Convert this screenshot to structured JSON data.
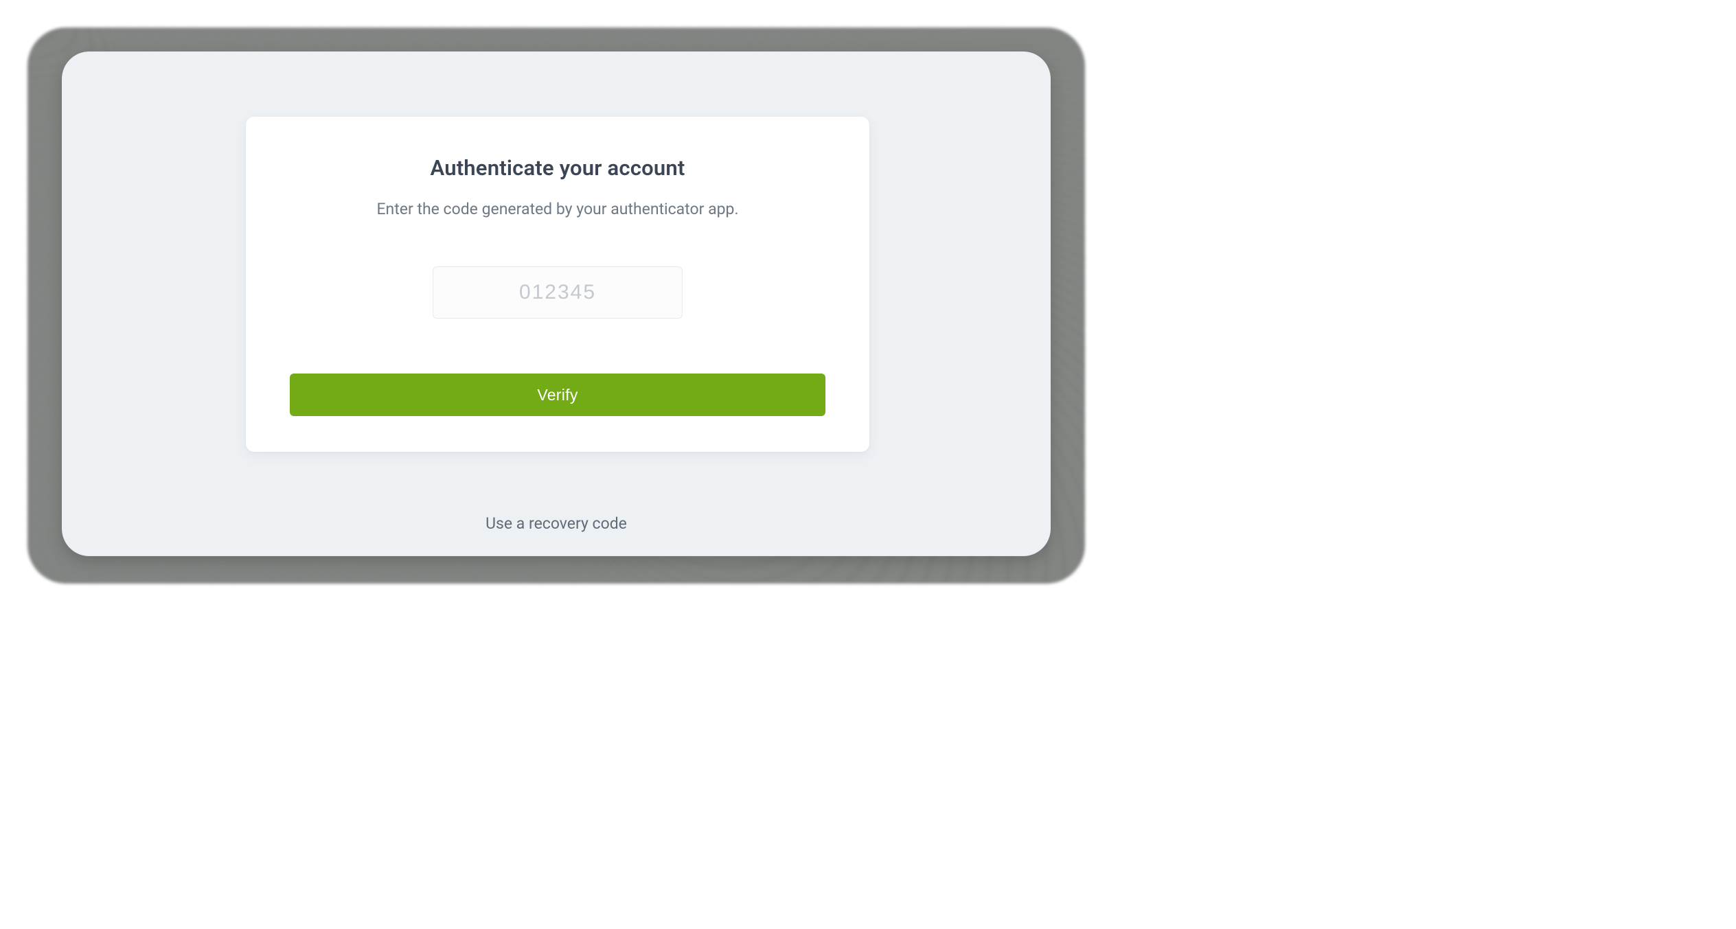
{
  "auth": {
    "title": "Authenticate your account",
    "subtitle": "Enter the code generated by your authenticator app.",
    "code_placeholder": "012345",
    "code_value": "",
    "verify_label": "Verify",
    "recovery_link_label": "Use a recovery code"
  },
  "colors": {
    "accent": "#72ab16",
    "panel_bg": "#eef1f4",
    "card_bg": "#ffffff",
    "title_text": "#3b4553",
    "subtitle_text": "#6d7884",
    "placeholder": "#c3c9cf",
    "link_text": "#5f6b78"
  }
}
